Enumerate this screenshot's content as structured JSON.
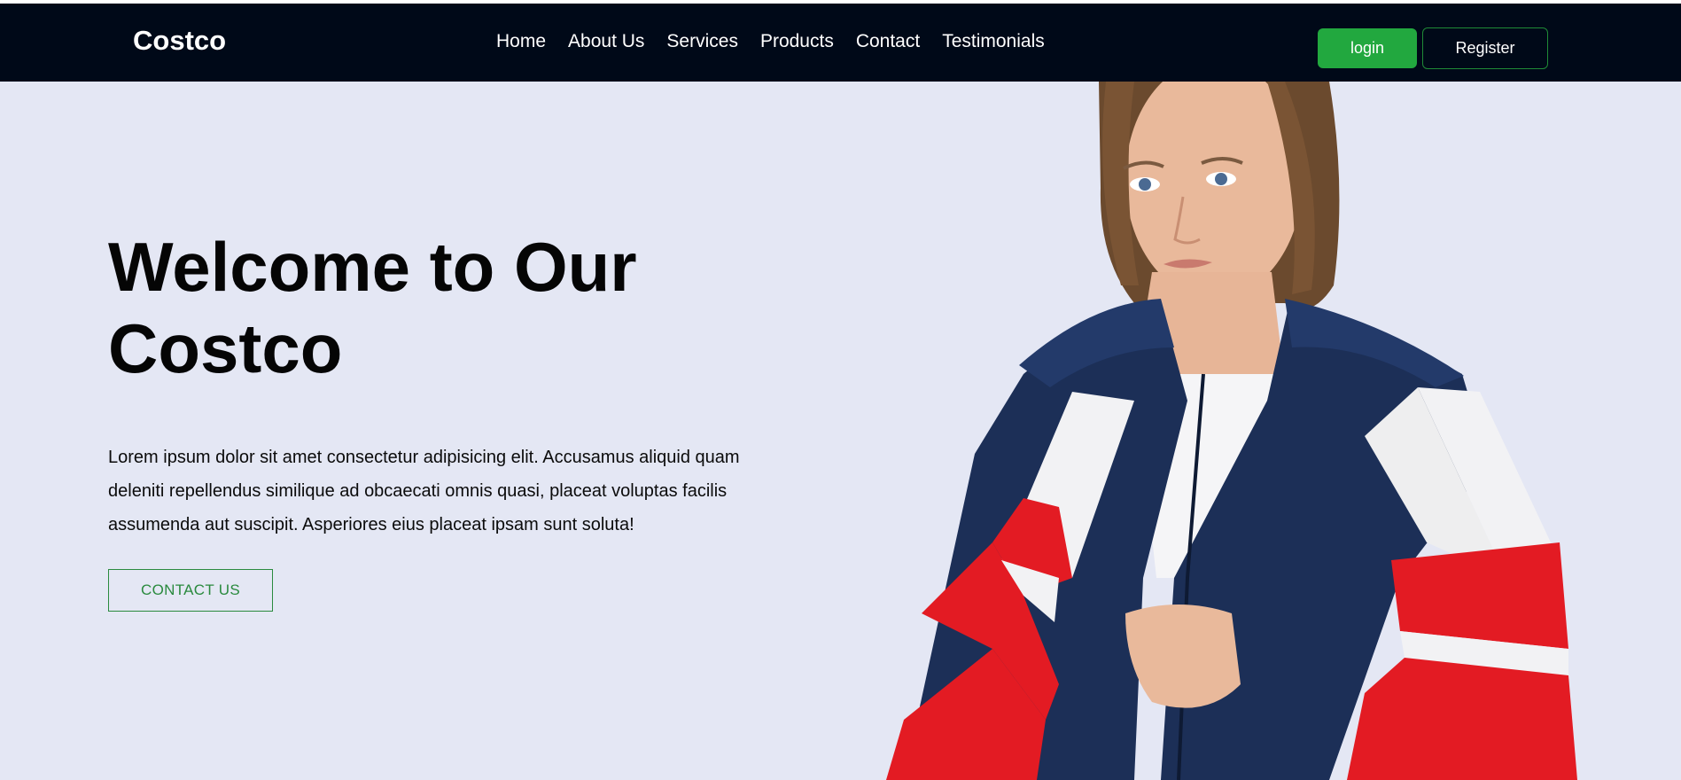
{
  "nav": {
    "brand": "Costco",
    "links": [
      "Home",
      "About Us",
      "Services",
      "Products",
      "Contact",
      "Testimonials"
    ],
    "login_label": "login",
    "register_label": "Register"
  },
  "hero": {
    "title_line1": "Welcome to Our",
    "title_line2": "Costco",
    "paragraph": "Lorem ipsum dolor sit amet consectetur adipisicing elit. Accusamus aliquid quam deleniti repellendus similique ad obcaecati omnis quasi, placeat voluptas facilis assumenda aut suscipit. Asperiores eius placeat ipsam sunt soluta!",
    "cta_label": "CONTACT US"
  },
  "colors": {
    "nav_bg": "#000918",
    "page_bg": "#e4e7f4",
    "accent_green": "#22a83f",
    "jacket_navy": "#1c2f57",
    "jacket_red": "#e31b23"
  }
}
